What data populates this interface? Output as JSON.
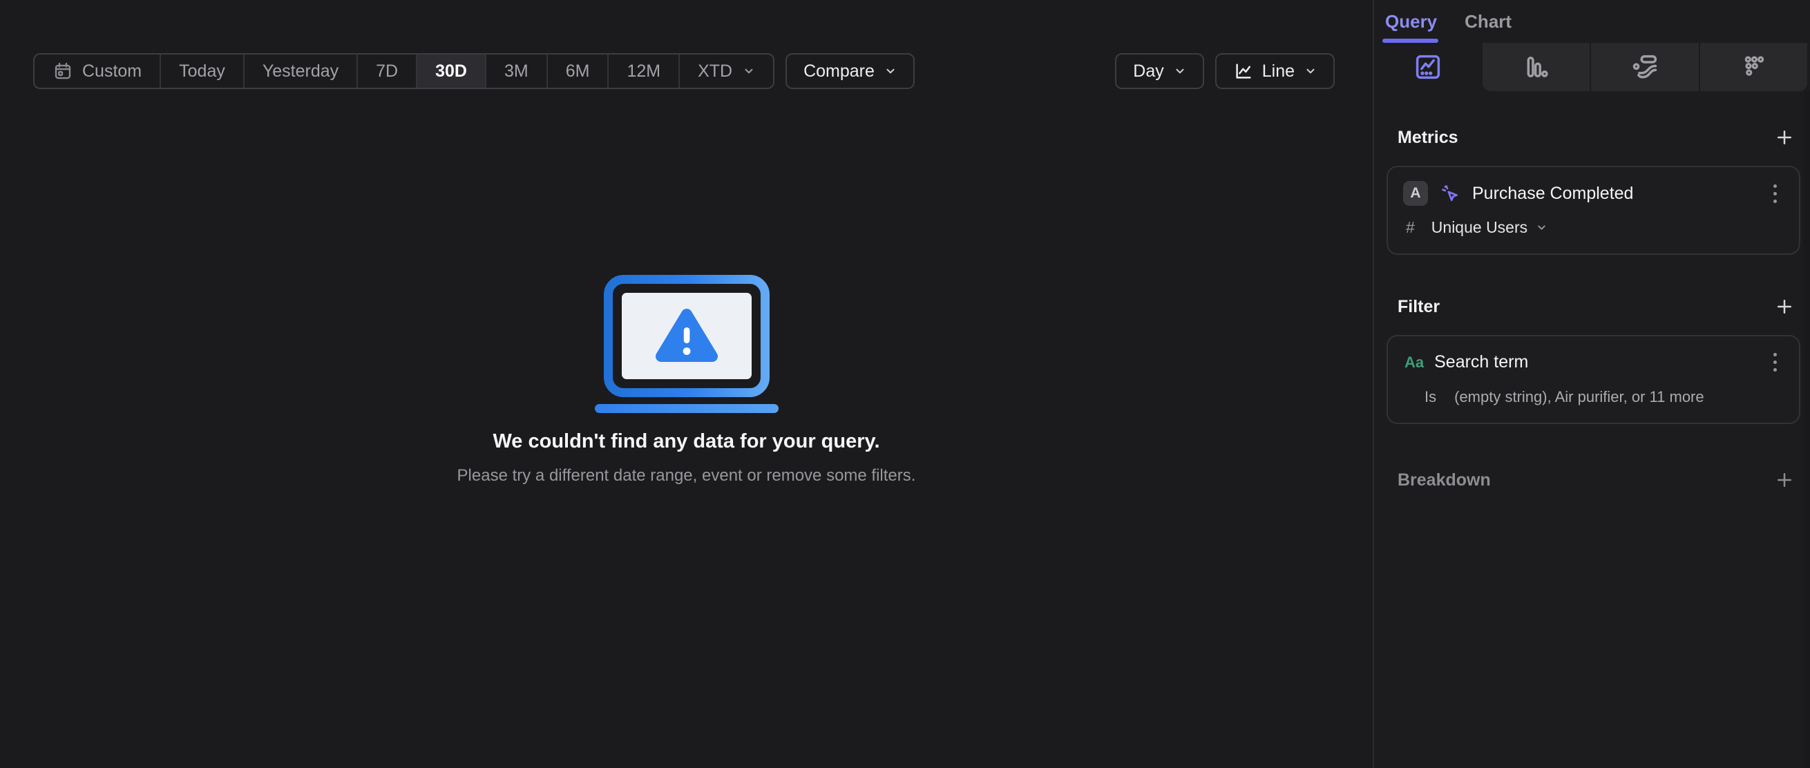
{
  "toolbar": {
    "ranges": [
      "Custom",
      "Today",
      "Yesterday",
      "7D",
      "30D",
      "3M",
      "6M",
      "12M",
      "XTD"
    ],
    "selected_range": "30D",
    "compare_label": "Compare",
    "granularity_label": "Day",
    "chart_style_label": "Line"
  },
  "empty_state": {
    "title": "We couldn't find any data for your query.",
    "subtitle": "Please try a different date range, event or remove some filters."
  },
  "sidebar": {
    "tabs": [
      {
        "label": "Query",
        "active": true
      },
      {
        "label": "Chart",
        "active": false
      }
    ],
    "chart_type_tabs": [
      "insights-line",
      "bar",
      "flows",
      "retention"
    ],
    "active_chart_type": "insights-line",
    "metrics": {
      "heading": "Metrics",
      "items": [
        {
          "badge": "A",
          "event_icon": "event-cursor-sparkle-icon",
          "name": "Purchase Completed",
          "aggregation_prefix": "#",
          "aggregation_label": "Unique Users"
        }
      ]
    },
    "filter": {
      "heading": "Filter",
      "items": [
        {
          "type_label": "Aa",
          "name": "Search term",
          "operator": "Is",
          "values_summary": "(empty string), Air purifier, or 11 more"
        }
      ]
    },
    "breakdown": {
      "heading": "Breakdown"
    }
  },
  "colors": {
    "accent_purple": "#7f7ff2",
    "underline_purple": "#6c6cf0",
    "illustration_blue": "#2f80ed",
    "illustration_blue_light": "#62aaf4",
    "property_green": "#3f9e7b",
    "selected_bg": "#2d2d31",
    "panel_bg": "#1c1c1e",
    "main_bg": "#1b1b1d"
  }
}
